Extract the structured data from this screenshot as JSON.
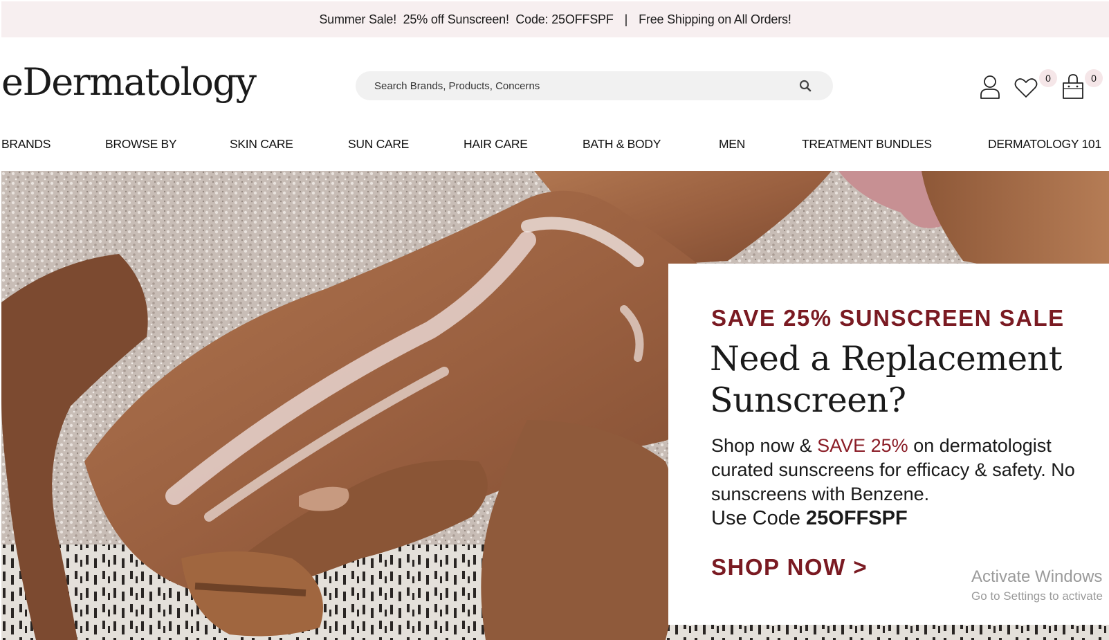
{
  "announcement": {
    "sale_text": "Summer Sale!  25% off Sunscreen!  Code: 25OFFSPF",
    "separator": "|",
    "shipping_text": "Free Shipping on All Orders!"
  },
  "header": {
    "logo": "eDermatology",
    "search": {
      "placeholder": "Search Brands, Products, Concerns"
    },
    "wishlist_count": "0",
    "cart_count": "0"
  },
  "nav": {
    "items": [
      {
        "label": "BRANDS"
      },
      {
        "label": "BROWSE BY"
      },
      {
        "label": "SKIN CARE"
      },
      {
        "label": "SUN CARE"
      },
      {
        "label": "HAIR CARE"
      },
      {
        "label": "BATH & BODY"
      },
      {
        "label": "MEN"
      },
      {
        "label": "TREATMENT BUNDLES"
      },
      {
        "label": "DERMATOLOGY 101"
      }
    ]
  },
  "hero": {
    "eyebrow": "SAVE 25% SUNSCREEN SALE",
    "headline": "Need a Replacement Sunscreen?",
    "body_prefix": "Shop now & ",
    "body_accent": "SAVE 25%",
    "body_suffix": " on dermatologist curated sunscreens for efficacy & safety. No sunscreens with Benzene.",
    "code_prefix": "Use Code ",
    "code": "25OFFSPF",
    "cta": "SHOP NOW >"
  },
  "os_watermark": {
    "line1": "Activate Windows",
    "line2": "Go to Settings to activate"
  },
  "colors": {
    "accent": "#7a1a22",
    "promo_bar_bg": "#f7eff0",
    "search_bg": "#f1f1f1"
  }
}
